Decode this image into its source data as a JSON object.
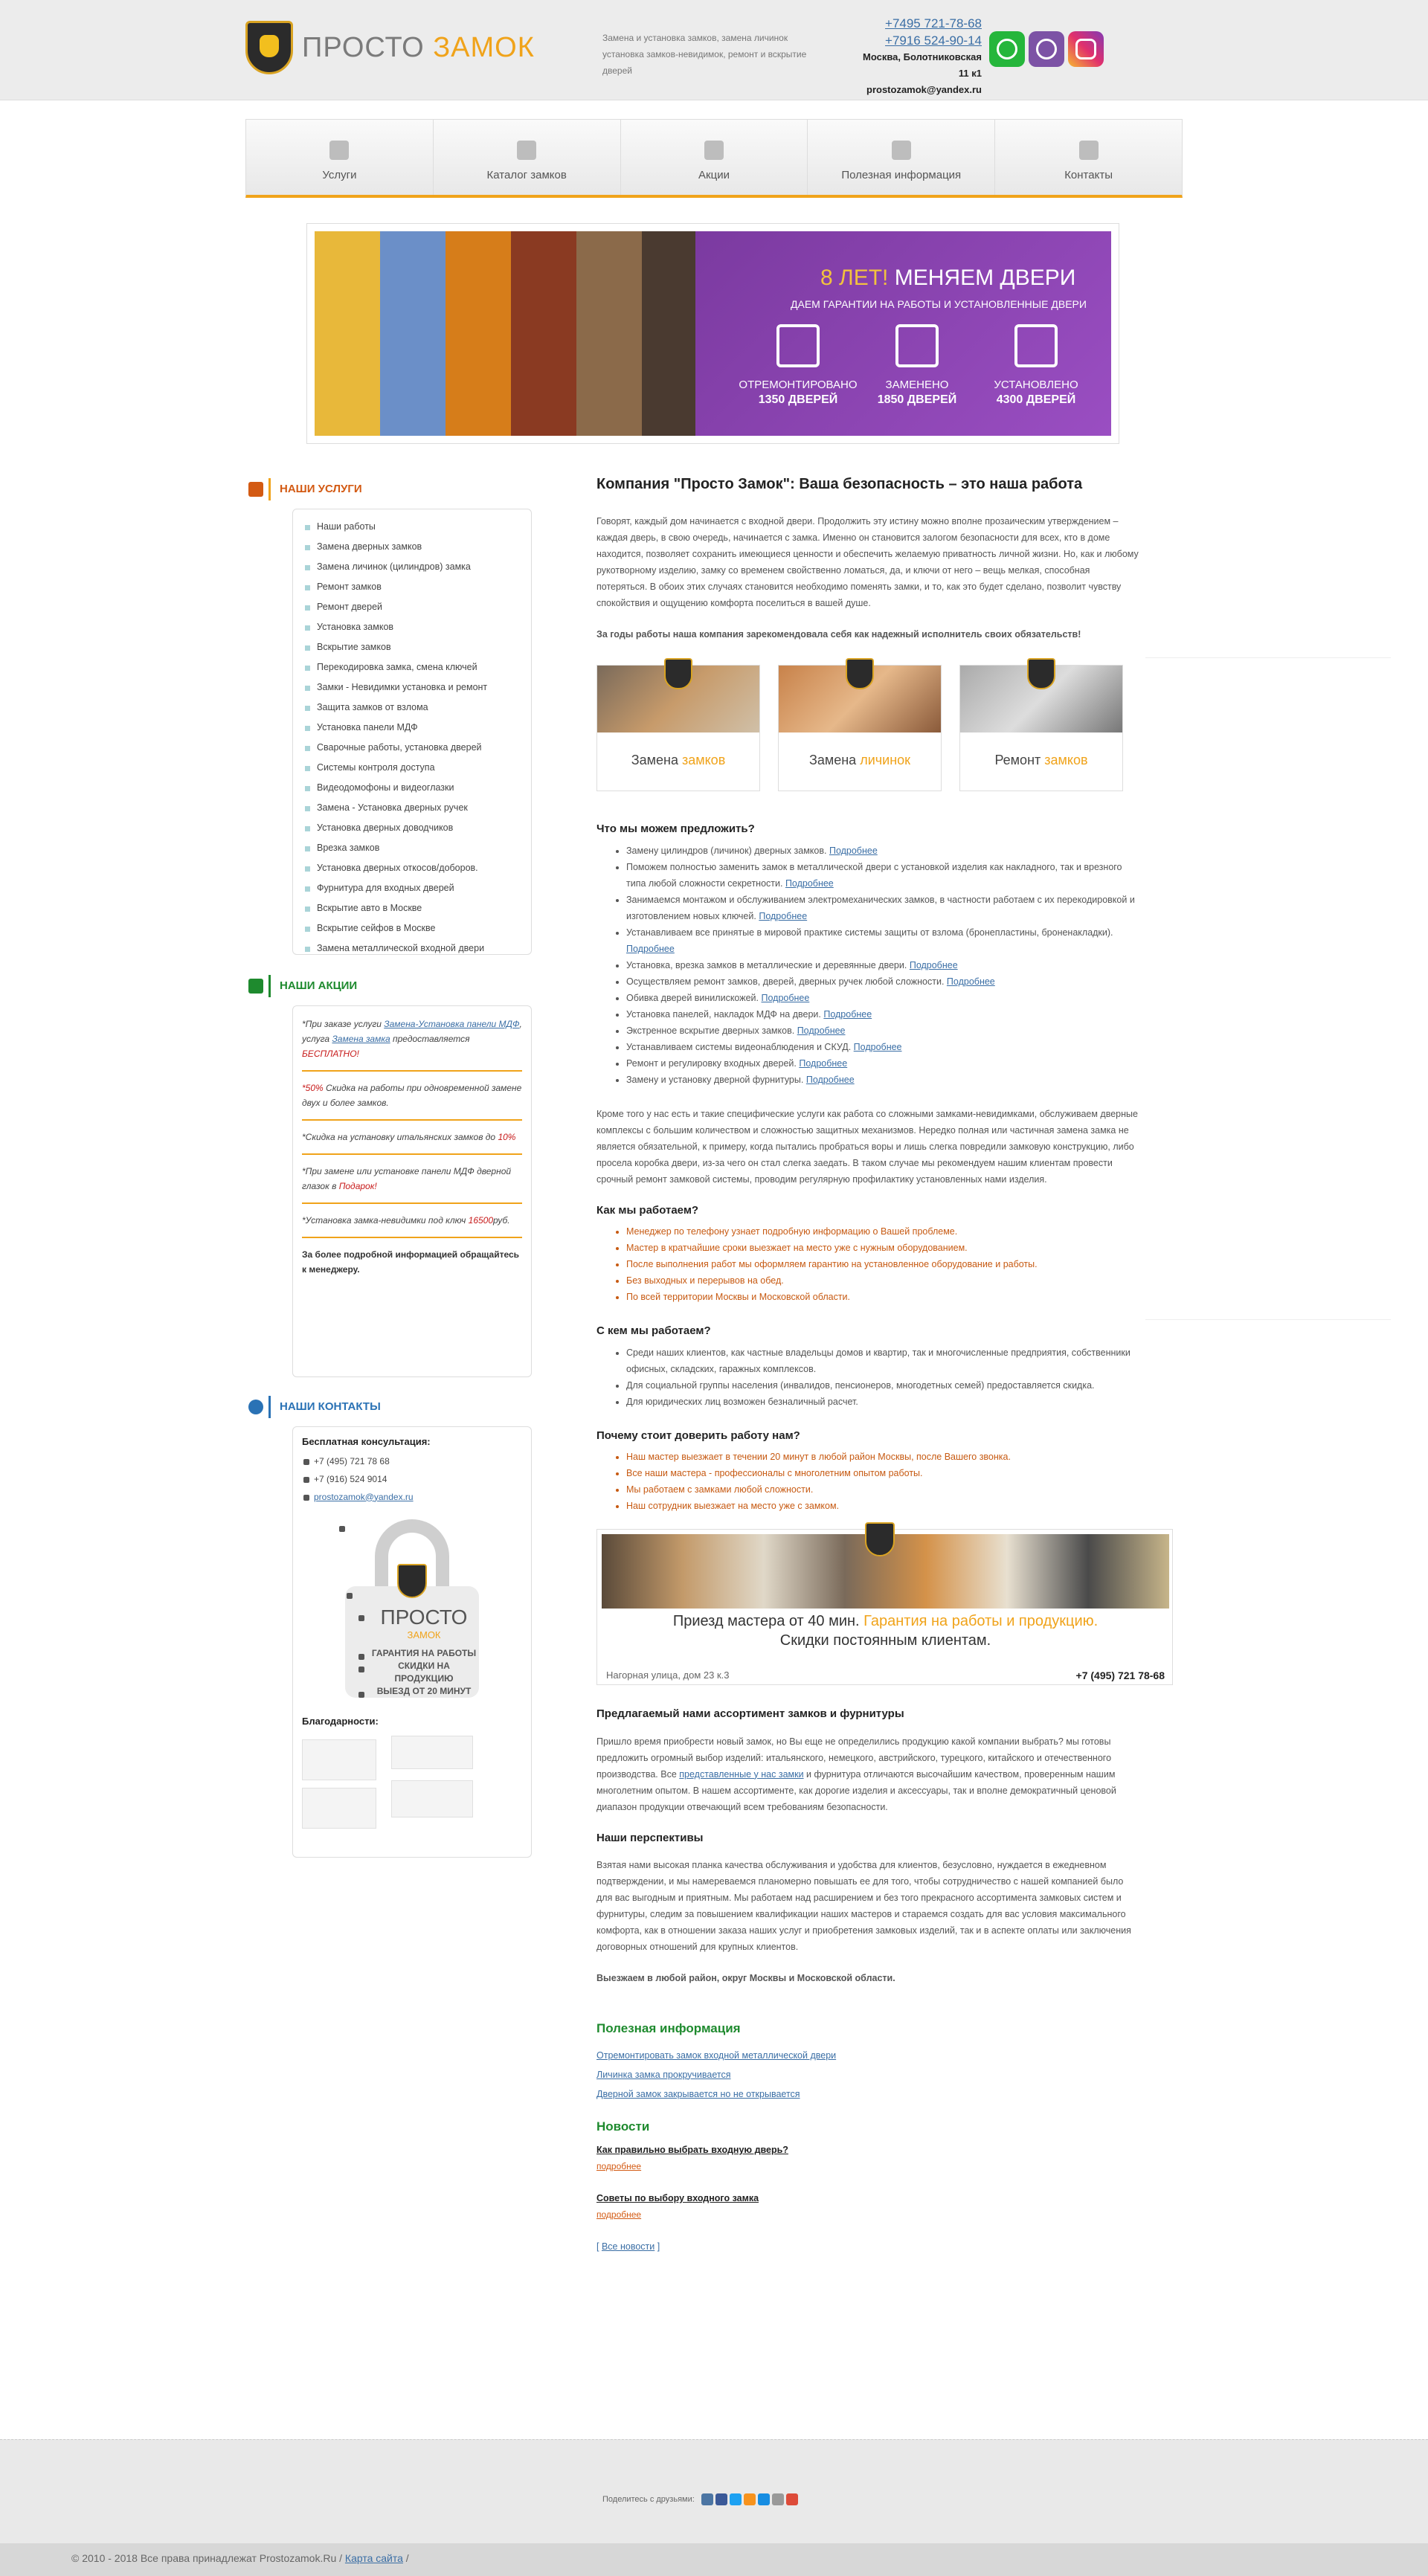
{
  "header": {
    "logo_a": "ПРОСТО",
    "logo_b": "ЗАМОК",
    "slogan": "Замена и установка замков, замена личинок установка замков-невидимок, ремонт и вскрытие дверей",
    "phone1": "+7495 721-78-68",
    "phone2": "+7916 524-90-14",
    "address": "Москва, Болотниковская 11 к1",
    "email": "prostozamok@yandex.ru",
    "social": [
      "whatsapp-icon",
      "viber-icon",
      "instagram-icon"
    ]
  },
  "nav": [
    "Услуги",
    "Каталог замков",
    "Акции",
    "Полезная информация",
    "Контакты"
  ],
  "banner": {
    "title_a": "8 ЛЕТ!",
    "title_b": "МЕНЯЕМ ДВЕРИ",
    "subtitle": "ДАЕМ ГАРАНТИИ НА РАБОТЫ И УСТАНОВЛЕННЫЕ ДВЕРИ",
    "stats": [
      {
        "label": "ОТРЕМОНТИРОВАНО",
        "value": "1350 ДВЕРЕЙ"
      },
      {
        "label": "ЗАМЕНЕНО",
        "value": "1850 ДВЕРЕЙ"
      },
      {
        "label": "УСТАНОВЛЕНО",
        "value": "4300 ДВЕРЕЙ"
      }
    ]
  },
  "services": {
    "title": "НАШИ УСЛУГИ",
    "items": [
      "Наши работы",
      "Замена дверных замков",
      "Замена личинок (цилиндров) замка",
      "Ремонт замков",
      "Ремонт дверей",
      "Установка замков",
      "Вскрытие замков",
      "Перекодировка замка, смена ключей",
      "Замки - Невидимки установка и ремонт",
      "Защита замков от взлома",
      "Установка панели МДФ",
      "Сварочные работы, установка дверей",
      "Системы контроля доступа",
      "Видеодомофоны и видеоглазки",
      "Замена - Установка дверных ручек",
      "Установка дверных доводчиков",
      "Врезка замков",
      "Установка дверных откосов/доборов.",
      "Фурнитура для входных дверей",
      "Вскрытие авто в Москве",
      "Вскрытие сейфов в Москве",
      "Замена металлической входной двери"
    ]
  },
  "promos": {
    "title": "НАШИ АКЦИИ",
    "p1_a": "*При заказе услуги ",
    "p1_link1": "Замена-Установка панели МДФ",
    "p1_b": ", услуга ",
    "p1_link2": "Замена замка",
    "p1_c": " предоставляется ",
    "p1_red": "БЕСПЛАТНО!",
    "p2_red": "*50%",
    "p2": " Скидка на работы при одновременной замене двух и более замков.",
    "p3": "*Скидка на установку итальянских замков до ",
    "p3_red": "10%",
    "p4": "*При замене или установке панели МДФ дверной глазок в ",
    "p4_red": "Подарок!",
    "p5": "*Установка замка-невидимки под ключ ",
    "p5_red": "16500",
    "p5_b": "руб.",
    "note": "За более подробной информацией обращайтесь к менеджеру."
  },
  "contacts": {
    "title": "НАШИ КОНТАКТЫ",
    "free": "Бесплатная консультация:",
    "phone1": "+7 (495) 721 78 68",
    "phone2": "+7 (916) 524 9014",
    "email": "prostozamok@yandex.ru",
    "lock_a": "ПРОСТО",
    "lock_b": "ЗАМОК",
    "lock_l1": "ГАРАНТИЯ НА РАБОТЫ",
    "lock_l2": "СКИДКИ НА ПРОДУКЦИЮ",
    "lock_l3": "ВЫЕЗД ОТ 20 МИНУТ",
    "thanks": "Благодарности:"
  },
  "main": {
    "h1": "Компания \"Просто Замок\": Ваша безопасность – это наша работа",
    "intro": "Говорят, каждый дом начинается с входной двери. Продолжить эту истину можно вполне прозаическим утверждением – каждая дверь, в свою очередь, начинается с замка. Именно он становится залогом безопасности для всех, кто в доме находится, позволяет сохранить имеющиеся ценности и обеспечить желаемую приватность личной жизни. Но, как и любому рукотворному изделию, замку со временем свойственно ломаться, да, и ключи от него – вещь мелкая, способная потеряться. В обоих этих случаях становится необходимо поменять замки, и то, как это будет сделано, позволит чувству спокойствия и ощущению комфорта поселиться в вашей душе.",
    "recommend": "За годы работы наша компания зарекомендовала себя как надежный исполнитель своих обязательств!",
    "cards": [
      {
        "a": "Замена ",
        "b": "замков"
      },
      {
        "a": "Замена ",
        "b": "личинок"
      },
      {
        "a": "Ремонт ",
        "b": "замков"
      }
    ],
    "offer_title": "Что мы можем предложить?",
    "more": "Подробнее",
    "offer": [
      "Замену цилиндров (личинок) дверных замков.",
      "Поможем полностью заменить замок в металлической двери с установкой изделия как накладного, так и врезного типа любой сложности секретности.",
      "Занимаемся монтажом и обслуживанием электромеханических замков, в частности работаем с их перекодировкой и изготовлением новых ключей.",
      "Устанавливаем все принятые в мировой практике системы защиты от взлома (бронепластины, броненакладки).",
      "Установка, врезка замков в металлические и деревянные двери.",
      "Осуществляем ремонт замков, дверей, дверных ручек любой сложности.",
      "Обивка дверей винилискожей.",
      "Установка панелей, накладок МДФ на двери.",
      "Экстренное вскрытие дверных замков.",
      "Устанавливаем системы видеонаблюдения и СКУД.",
      "Ремонт и регулировку входных дверей.",
      "Замену и установку дверной фурнитуры."
    ],
    "p2": "Кроме того у нас есть и такие специфические услуги как работа со сложными замками-невидимками, обслуживаем дверные комплексы с большим количеством и сложностью защитных механизмов. Нередко полная или частичная замена замка не является обязательной, к примеру, когда пытались пробраться воры и лишь слегка повредили замковую конструкцию, либо просела коробка двери, из-за чего он стал слегка заедать. В таком случае мы рекомендуем нашим клиентам провести срочный ремонт замковой системы, проводим регулярную профилактику установленных нами изделия.",
    "how_title": "Как мы работаем?",
    "how": [
      "Менеджер по телефону узнает подробную информацию о Вашей проблеме.",
      "Мастер в кратчайшие сроки выезжает на место уже с нужным оборудованием.",
      "После выполнения работ мы оформляем гарантию на установленное оборудование и работы.",
      "Без выходных и перерывов на обед.",
      "По всей территории Москвы и Московской области."
    ],
    "who_title": "С кем мы работаем?",
    "who": [
      "Среди наших клиентов, как частные владельцы домов и квартир, так и многочисленные предприятия, собственники офисных, складских, гаражных комплексов.",
      "Для социальной группы населения (инвалидов, пенсионеров, многодетных семей) предоставляется скидка.",
      "Для юридических лиц возможен безналичный расчет."
    ],
    "why_title": "Почему стоит доверить работу нам?",
    "why": [
      "Наш мастер выезжает в течении 20 минут в любой район Москвы, после Вашего звонка.",
      "Все наши мастера - профессионалы с многолетним опытом работы.",
      "Мы работаем с замками любой сложности.",
      "Наш сотрудник выезжает на место уже с замком."
    ],
    "ad_l1a": "Приезд мастера от 40 мин. ",
    "ad_l1b": "Гарантия на работы и продукцию.",
    "ad_l2": "Скидки постоянным клиентам.",
    "ad_address": "Нагорная улица, дом 23 к.3",
    "ad_phone": "+7 (495) 721 78-68",
    "assort_title": "Предлагаемый нами ассортимент замков и фурнитуры",
    "assort_a": "Пришло время приобрести новый замок, но Вы еще не определились продукцию какой компании выбрать? мы готовы предложить огромный выбор изделий: итальянского, немецкого, австрийского, турецкого, китайского и отечественного производства. Все ",
    "assort_link": "представленные у нас замки",
    "assort_b": " и фурнитура отличаются высочайшим качеством, проверенным нашим многолетним опытом. В нашем ассортименте, как дорогие изделия и аксессуары, так и вполне демократичный ценовой диапазон продукции отвечающий всем требованиям безопасности.",
    "persp_title": "Наши перспективы",
    "persp": "Взятая нами высокая планка качества обслуживания и удобства для клиентов, безусловно, нуждается в ежедневном подтверждении, и мы намереваемся планомерно повышать ее для того, чтобы сотрудничество с нашей компанией было для вас выгодным и приятным. Мы работаем над расширением и без того прекрасного ассортимента замковых систем и фурнитуры, следим за повышением квалификации наших мастеров и стараемся создать для вас условия максимального комфорта, как в отношении заказа наших услуг и приобретения замковых изделий, так и в аспекте оплаты или заключения договорных отношений для крупных клиентов.",
    "travel": "Выезжаем в любой район, округ Москвы и Московской области.",
    "useful_title": "Полезная информация",
    "useful": [
      "Отремонтировать замок входной металлической двери",
      "Личинка замка прокручивается",
      "Дверной замок закрывается но не открывается"
    ],
    "news_title": "Новости",
    "news": [
      {
        "title": "Как правильно выбрать входную дверь?",
        "more": "подробнее"
      },
      {
        "title": "Советы по выбору входного замка",
        "more": "подробнее"
      }
    ],
    "all_news": "Все новости"
  },
  "footer": {
    "share": "Поделитесь с друзьями:",
    "copyright": "© 2010 - 2018 Все права принадлежат Prostozamok.Ru / ",
    "sitemap": "Карта сайта",
    "slash": " /"
  },
  "colors": {
    "accent": "#f0a31a",
    "purple": "#7b3aa0",
    "link": "#3a6ea5",
    "red": "#c71a1a",
    "green": "#1e8a2e"
  }
}
